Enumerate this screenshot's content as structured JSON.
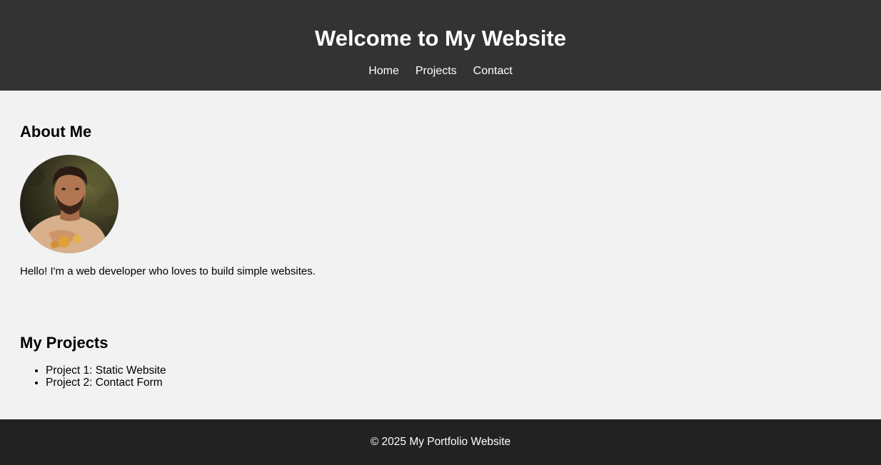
{
  "header": {
    "title": "Welcome to My Website",
    "nav": [
      {
        "label": "Home"
      },
      {
        "label": "Projects"
      },
      {
        "label": "Contact"
      }
    ]
  },
  "about": {
    "heading": "About Me",
    "avatar_icon": "profile-photo",
    "text": "Hello! I'm a web developer who loves to build simple websites."
  },
  "projects": {
    "heading": "My Projects",
    "items": [
      "Project 1: Static Website",
      "Project 2: Contact Form"
    ]
  },
  "footer": {
    "text": "© 2025 My Portfolio Website"
  },
  "colors": {
    "header_bg": "#333333",
    "footer_bg": "#222222",
    "page_bg": "#f2f2f2"
  }
}
